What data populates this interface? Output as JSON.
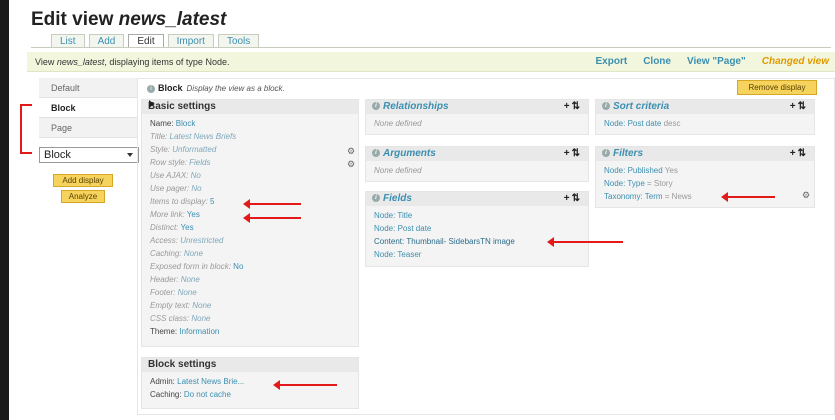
{
  "page": {
    "title_prefix": "Edit view ",
    "title_name": "news_latest"
  },
  "tabs": [
    "List",
    "Add",
    "Edit",
    "Import",
    "Tools"
  ],
  "viewbar": {
    "text_prefix": "View ",
    "text_name": "news_latest",
    "text_suffix": ", displaying items of type Node.",
    "links": [
      "Export",
      "Clone",
      "View \"Page\""
    ],
    "changed": "Changed view"
  },
  "sidebar": {
    "items": [
      "Default",
      "Block",
      "Page"
    ],
    "select_value": "Block",
    "add_display": "Add display",
    "analyze": "Analyze"
  },
  "display": {
    "name": "Block",
    "desc": "Display the view as a block.",
    "remove_button": "Remove display"
  },
  "basic": {
    "title": "Basic settings",
    "rows": [
      {
        "k": "Name:",
        "v": "Block"
      },
      {
        "k": "Title:",
        "v": "Latest News Briefs"
      },
      {
        "k": "Style:",
        "v": "Unformatted"
      },
      {
        "k": "Row style:",
        "v": "Fields"
      },
      {
        "k": "Use AJAX:",
        "v": "No"
      },
      {
        "k": "Use pager:",
        "v": "No"
      },
      {
        "k": "Items to display:",
        "v": "5"
      },
      {
        "k": "More link:",
        "v": "Yes"
      },
      {
        "k": "Distinct:",
        "v": "Yes"
      },
      {
        "k": "Access:",
        "v": "Unrestricted"
      },
      {
        "k": "Caching:",
        "v": "None"
      },
      {
        "k": "Exposed form in block:",
        "v": "No"
      },
      {
        "k": "Header:",
        "v": "None"
      },
      {
        "k": "Footer:",
        "v": "None"
      },
      {
        "k": "Empty text:",
        "v": "None"
      },
      {
        "k": "CSS class:",
        "v": "None"
      },
      {
        "k": "Theme:",
        "v": "Information"
      }
    ]
  },
  "block_settings": {
    "title": "Block settings",
    "rows": [
      {
        "k": "Admin:",
        "v": "Latest News Brie..."
      },
      {
        "k": "Caching:",
        "v": "Do not cache"
      }
    ]
  },
  "relationships": {
    "title": "Relationships",
    "empty": "None defined"
  },
  "arguments": {
    "title": "Arguments",
    "empty": "None defined"
  },
  "fields": {
    "title": "Fields",
    "rows": [
      "Node: Title",
      "Node: Post date",
      "Content: Thumbnail- SidebarsTN image",
      "Node: Teaser"
    ]
  },
  "sort": {
    "title": "Sort criteria",
    "row_k": "Node: Post date",
    "row_v": "desc"
  },
  "filters": {
    "title": "Filters",
    "rows": [
      {
        "k": "Node: Published",
        "v": "Yes"
      },
      {
        "k": "Node: Type",
        "v": "= Story"
      },
      {
        "k": "Taxonomy: Term",
        "v": "= News"
      }
    ]
  },
  "icons": {
    "info": "info-icon",
    "gear": "gear-icon",
    "add": "plus-icon",
    "rearrange": "rearrange-icon"
  },
  "colors": {
    "link": "#3b8fb0",
    "accent_button": "#f6d35c",
    "changed": "#e09a00",
    "annotation": "#e21a1a"
  }
}
